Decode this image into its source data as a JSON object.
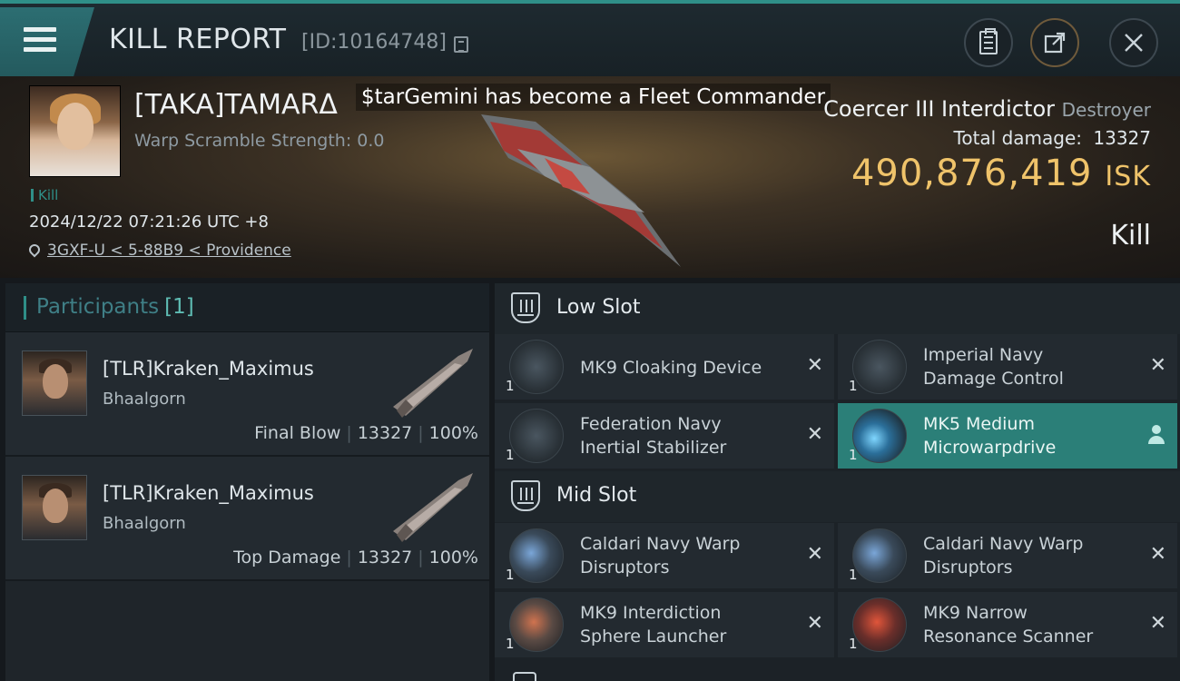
{
  "header": {
    "title": "KILL REPORT",
    "report_id": "[ID:10164748]"
  },
  "victim": {
    "name": "[TAKA]TAMARΔ",
    "warp_scramble": "Warp Scramble Strength: 0.0",
    "kill_tag": "Kill",
    "datetime": "2024/12/22 07:21:26 UTC +8",
    "location": "3GXF-U < 5-88B9 < Providence",
    "notice": "$tarGemini has become a Fleet Commander",
    "ship_name": "Coercer III Interdictor",
    "ship_class": "Destroyer",
    "total_damage_label": "Total damage:",
    "total_damage_value": "13327",
    "isk_value": "490,876,419",
    "isk_unit": "ISK",
    "result": "Kill"
  },
  "participants": {
    "title": "Participants",
    "count": "[1]",
    "rows": [
      {
        "name": "[TLR]Kraken_Maximus",
        "corp": "Bhaalgorn",
        "role": "Final Blow",
        "damage": "13327",
        "percent": "100%"
      },
      {
        "name": "[TLR]Kraken_Maximus",
        "corp": "Bhaalgorn",
        "role": "Top Damage",
        "damage": "13327",
        "percent": "100%"
      }
    ]
  },
  "fitting": {
    "low_slot_label": "Low Slot",
    "mid_slot_label": "Mid Slot",
    "low": [
      {
        "name_1": "MK9 Cloaking Device",
        "name_2": "",
        "qty": "1"
      },
      {
        "name_1": "Imperial Navy",
        "name_2": "Damage Control",
        "qty": "1"
      },
      {
        "name_1": "Federation Navy",
        "name_2": "Inertial Stabilizer",
        "qty": "1"
      },
      {
        "name_1": "MK5 Medium",
        "name_2": "Microwarpdrive",
        "qty": "1"
      }
    ],
    "mid": [
      {
        "name_1": "Caldari Navy Warp",
        "name_2": "Disruptors",
        "qty": "1"
      },
      {
        "name_1": "Caldari Navy Warp",
        "name_2": "Disruptors",
        "qty": "1"
      },
      {
        "name_1": "MK9 Interdiction",
        "name_2": "Sphere Launcher",
        "qty": "1"
      },
      {
        "name_1": "MK9 Narrow",
        "name_2": "Resonance Scanner",
        "qty": "1"
      }
    ]
  },
  "colors": {
    "accent": "#2f8f88",
    "isk": "#efc36a",
    "active_module": "#2b7f78"
  },
  "icons": [
    "menu-icon",
    "copy-icon",
    "clipboard-icon",
    "share-icon",
    "close-icon",
    "map-pin-icon",
    "slot-icon",
    "remove-x-icon",
    "user-icon"
  ]
}
